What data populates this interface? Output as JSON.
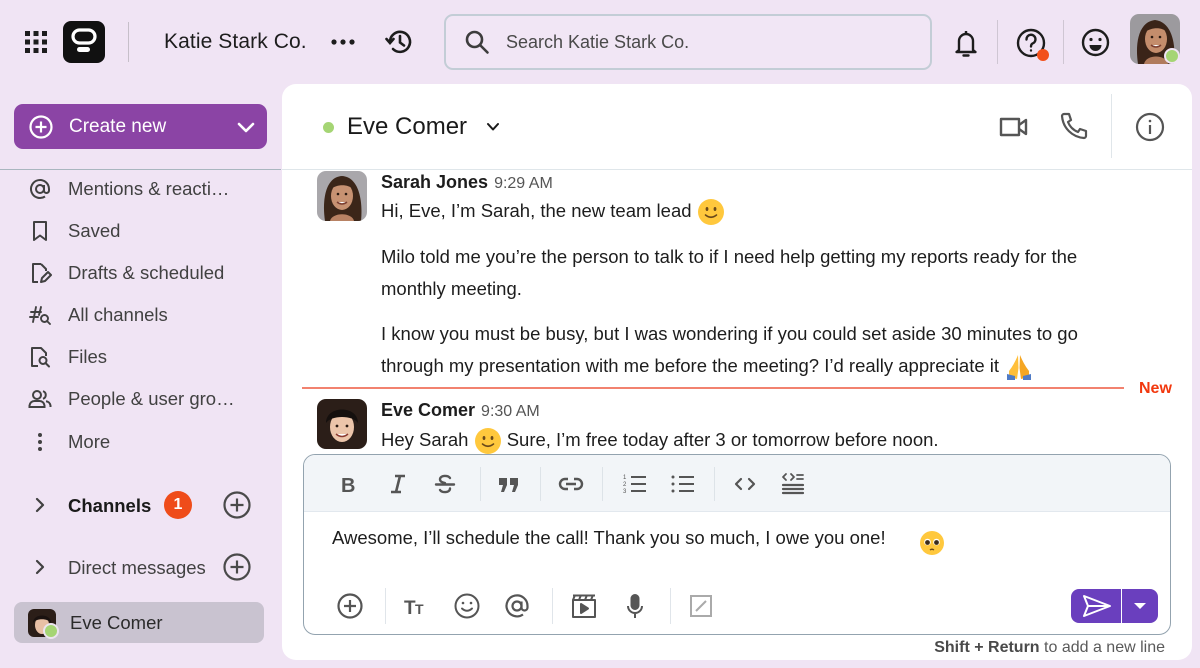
{
  "topbar": {
    "workspace_name": "Katie Stark Co.",
    "search_placeholder": "Search Katie Stark Co.",
    "icons": [
      "apps-grid-icon",
      "app-logo",
      "more-icon",
      "history-icon",
      "search-icon",
      "bell-icon",
      "help-icon",
      "emoji-status-icon",
      "user-avatar"
    ],
    "help_has_notification": true,
    "user_status": "online"
  },
  "sidebar": {
    "create_new_label": "Create new",
    "nav_items": [
      {
        "label": "Mentions & reacti…",
        "icon": "at-icon"
      },
      {
        "label": "Saved",
        "icon": "bookmark-icon"
      },
      {
        "label": "Drafts & scheduled",
        "icon": "draft-edit-icon"
      },
      {
        "label": "All channels",
        "icon": "channel-search-icon"
      },
      {
        "label": "Files",
        "icon": "file-search-icon"
      },
      {
        "label": "People & user gro…",
        "icon": "people-icon"
      },
      {
        "label": "More",
        "icon": "more-vertical-icon"
      }
    ],
    "channels": {
      "label": "Channels",
      "badge": "1"
    },
    "direct_messages": {
      "label": "Direct messages"
    },
    "dm_items": [
      {
        "label": "Eve Comer",
        "status": "online",
        "selected": true
      }
    ]
  },
  "chat": {
    "title": "Eve Comer",
    "status": "online",
    "messages": [
      {
        "author": "Sarah Jones",
        "time": "9:29 AM",
        "paragraphs": [
          {
            "text": "Hi, Eve, I’m Sarah, the new team lead",
            "emoji": "🙂"
          },
          {
            "text": "Milo told me you’re the person to talk to if I need help getting my reports ready for the monthly meeting.",
            "emoji": ""
          },
          {
            "text": "I know you must be busy, but I was wondering if you could set aside 30 minutes to go through my presentation with me before the meeting? I’d really appreciate it",
            "emoji": "🙏"
          }
        ]
      },
      {
        "author": "Eve Comer",
        "time": "9:30 AM",
        "paragraphs": [
          {
            "text_before": "Hey Sarah",
            "emoji": "🙂",
            "text_after": "Sure, I’m free today after 3 or tomorrow before noon."
          }
        ]
      }
    ],
    "new_divider_label": "New"
  },
  "composer": {
    "draft_text": "Awesome, I’ll schedule the call! Thank you so much, I owe you one!",
    "draft_emoji": "🥺",
    "format_tools": [
      "bold",
      "italic",
      "strikethrough",
      "quote",
      "link",
      "numbered-list",
      "bulleted-list",
      "code",
      "code-block"
    ],
    "action_tools": [
      "attach",
      "text-format",
      "emoji",
      "mention",
      "video-clip",
      "voice-memo",
      "slash-command"
    ],
    "hint_bold": "Shift + Return",
    "hint_rest": " to add a new line"
  },
  "colors": {
    "brand_purple": "#8b44a5",
    "send_purple": "#6a3fbe",
    "online_green": "#a5d574",
    "badge_red": "#ef4c1a",
    "new_red": "#f2380e"
  }
}
